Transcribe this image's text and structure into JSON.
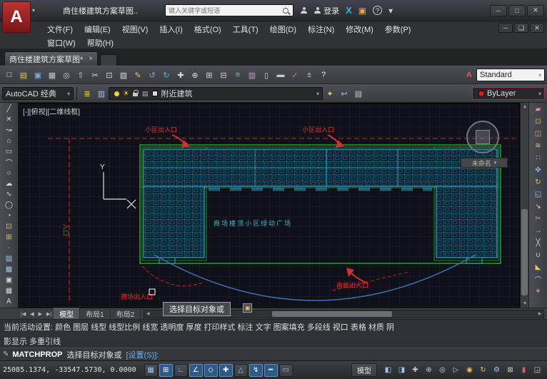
{
  "titlebar": {
    "logo_letter": "A",
    "doc_title": "商住楼建筑方案草图..",
    "search_placeholder": "键入关键字或短语",
    "login": "登录",
    "exchange": "X",
    "box_icon": "▣",
    "help": "?",
    "dropdown": "▾"
  },
  "window": {
    "minimize": "─",
    "maximize": "□",
    "close": "✕"
  },
  "doc_window": {
    "minimize": "─",
    "maximize": "❏",
    "close": "✕"
  },
  "menus": [
    "文件(F)",
    "编辑(E)",
    "视图(V)",
    "插入(I)",
    "格式(O)",
    "工具(T)",
    "绘图(D)",
    "标注(N)",
    "修改(M)",
    "参数(P)"
  ],
  "menus2": [
    "窗口(W)",
    "帮助(H)"
  ],
  "doc_tab": {
    "label": "商住楼建筑方案草图*",
    "close": "×"
  },
  "toolbar1": [
    {
      "name": "qnew-icon",
      "glyph": "□",
      "color": "#e8e8e8"
    },
    {
      "name": "open-icon",
      "glyph": "▤",
      "color": "#e8c35a"
    },
    {
      "name": "save-icon",
      "glyph": "▣",
      "color": "#7fa8d9"
    },
    {
      "name": "plot-icon",
      "glyph": "▦",
      "color": "#c9c9c9"
    },
    {
      "name": "plot-preview-icon",
      "glyph": "◎",
      "color": "#c9c9c9"
    },
    {
      "name": "publish-icon",
      "glyph": "⇧",
      "color": "#c9c9c9"
    },
    {
      "name": "cut-icon",
      "glyph": "✂",
      "color": "#d9d9d9"
    },
    {
      "name": "copy-icon",
      "glyph": "⊡",
      "color": "#d9d9d9"
    },
    {
      "name": "paste-icon",
      "glyph": "▧",
      "color": "#d9d9d9"
    },
    {
      "name": "matchprop-icon",
      "glyph": "✎",
      "color": "#e8c35a"
    },
    {
      "name": "undo-icon",
      "glyph": "↺",
      "color": "#6fa8e0"
    },
    {
      "name": "redo-icon",
      "glyph": "↻",
      "color": "#6fa8e0"
    },
    {
      "name": "pan-icon",
      "glyph": "✚",
      "color": "#d9d9d9"
    },
    {
      "name": "zoom-realtime-icon",
      "glyph": "⊕",
      "color": "#d9d9d9"
    },
    {
      "name": "zoom-window-icon",
      "glyph": "⊞",
      "color": "#d9d9d9"
    },
    {
      "name": "zoom-previous-icon",
      "glyph": "⊟",
      "color": "#d9d9d9"
    },
    {
      "name": "properties-icon",
      "glyph": "≡",
      "color": "#8fc08f"
    },
    {
      "name": "designcenter-icon",
      "glyph": "▥",
      "color": "#c9a0c9"
    },
    {
      "name": "toolpalettes-icon",
      "glyph": "▯",
      "color": "#c9c9c9"
    },
    {
      "name": "sheetset-icon",
      "glyph": "▬",
      "color": "#c9c9c9"
    },
    {
      "name": "markup-icon",
      "glyph": "✓",
      "color": "#e07070"
    },
    {
      "name": "quickcalc-icon",
      "glyph": "±",
      "color": "#c9c9c9"
    },
    {
      "name": "help-icon",
      "glyph": "?",
      "color": "#efefef"
    }
  ],
  "standard": {
    "style_icon": "A",
    "combo": "Standard"
  },
  "toolbar2": {
    "workspace": "AutoCAD 经典",
    "icons_left": [
      {
        "name": "layer-properties-icon",
        "glyph": "≣",
        "color": "#e8c35a"
      },
      {
        "name": "layer-filter-icon",
        "glyph": "▥",
        "color": "#9fc3e8"
      }
    ],
    "layer": "附近建筑",
    "icons_right": [
      {
        "name": "make-object-layer-current-icon",
        "glyph": "✦",
        "color": "#e8c35a"
      },
      {
        "name": "layer-previous-icon",
        "glyph": "↩",
        "color": "#9fc3e8"
      },
      {
        "name": "layer-states-icon",
        "glyph": "▤",
        "color": "#c9c9c9"
      }
    ],
    "color": "ByLayer"
  },
  "draw_toolbar": [
    {
      "name": "line-icon",
      "glyph": "╱",
      "color": "#d5d5d5"
    },
    {
      "name": "construction-line-icon",
      "glyph": "✕",
      "color": "#d5d5d5"
    },
    {
      "name": "polyline-icon",
      "glyph": "↝",
      "color": "#d5d5d5"
    },
    {
      "name": "polygon-icon",
      "glyph": "⌂",
      "color": "#d5d5d5"
    },
    {
      "name": "rectangle-icon",
      "glyph": "▭",
      "color": "#d5d5d5"
    },
    {
      "name": "arc-icon",
      "glyph": "⌒",
      "color": "#d5d5d5"
    },
    {
      "name": "circle-icon",
      "glyph": "○",
      "color": "#d5d5d5"
    },
    {
      "name": "revision-cloud-icon",
      "glyph": "☁",
      "color": "#d5d5d5"
    },
    {
      "name": "spline-icon",
      "glyph": "∿",
      "color": "#d5d5d5"
    },
    {
      "name": "ellipse-icon",
      "glyph": "◯",
      "color": "#d5d5d5"
    },
    {
      "name": "ellipse-arc-icon",
      "glyph": "◔",
      "color": "#d5d5d5"
    },
    {
      "name": "insert-block-icon",
      "glyph": "⊡",
      "color": "#e8c35a"
    },
    {
      "name": "make-block-icon",
      "glyph": "⊞",
      "color": "#e8c35a"
    },
    {
      "name": "point-icon",
      "glyph": "∙",
      "color": "#d5d5d5"
    },
    {
      "name": "hatch-icon",
      "glyph": "▨",
      "color": "#9fc3e8"
    },
    {
      "name": "gradient-icon",
      "glyph": "▩",
      "color": "#9fc3e8"
    },
    {
      "name": "region-icon",
      "glyph": "▣",
      "color": "#d5d5d5"
    },
    {
      "name": "table-icon",
      "glyph": "▦",
      "color": "#d5d5d5"
    },
    {
      "name": "mtext-icon",
      "glyph": "A",
      "color": "#d5d5d5"
    }
  ],
  "modify_toolbar": [
    {
      "name": "erase-icon",
      "glyph": "▰",
      "color": "#e09090"
    },
    {
      "name": "copy-object-icon",
      "glyph": "⊡",
      "color": "#e8a060"
    },
    {
      "name": "mirror-icon",
      "glyph": "◫",
      "color": "#e8a060"
    },
    {
      "name": "offset-icon",
      "glyph": "≋",
      "color": "#e8c35a"
    },
    {
      "name": "array-icon",
      "glyph": "∷",
      "color": "#d5d5d5"
    },
    {
      "name": "move-icon",
      "glyph": "✜",
      "color": "#9fc3e8"
    },
    {
      "name": "rotate-icon",
      "glyph": "↻",
      "color": "#e8c35a"
    },
    {
      "name": "scale-icon",
      "glyph": "◱",
      "color": "#9fc3e8"
    },
    {
      "name": "stretch-icon",
      "glyph": "↘",
      "color": "#d5d5d5"
    },
    {
      "name": "trim-icon",
      "glyph": "✂",
      "color": "#e09090"
    },
    {
      "name": "extend-icon",
      "glyph": "→",
      "color": "#9fc3e8"
    },
    {
      "name": "break-icon",
      "glyph": "╳",
      "color": "#d5d5d5"
    },
    {
      "name": "join-icon",
      "glyph": "∪",
      "color": "#d5d5d5"
    },
    {
      "name": "chamfer-icon",
      "glyph": "◣",
      "color": "#e8c35a"
    },
    {
      "name": "fillet-icon",
      "glyph": "⌒",
      "color": "#9fc3e8"
    },
    {
      "name": "explode-icon",
      "glyph": "✶",
      "color": "#e09090"
    }
  ],
  "viewport": {
    "label": "[-][俯视][二维线框]",
    "viewcube": "未命名"
  },
  "plan": {
    "annotations": {
      "entrance_top_left": "小区出入口",
      "entrance_top_right": "小区出入口",
      "plaza": "商场楼顶小区绿动广场",
      "entrance_bottom_right": "南板出入口",
      "entrance_bottom_left": "商场出入口",
      "entrance_left": "入口",
      "axis_y": "Y"
    }
  },
  "layout": {
    "nav": [
      {
        "name": "tab-first-button",
        "glyph": "|◀"
      },
      {
        "name": "tab-prev-button",
        "glyph": "◀"
      },
      {
        "name": "tab-next-button",
        "glyph": "▶"
      },
      {
        "name": "tab-last-button",
        "glyph": "▶|"
      }
    ],
    "tabs": [
      "模型",
      "布局1",
      "布局2"
    ]
  },
  "tooltip": {
    "text": "选择目标对象或",
    "badge": "▣"
  },
  "status_info": {
    "line1": "当前活动设置:  颜色  图层  线型  线型比例  线宽  透明度  厚度  打印样式  标注  文字  图案填充  多段线  视口  表格  材质  阴",
    "line2": "影显示  多重引线"
  },
  "command": {
    "icon": "✎",
    "name": "MATCHPROP",
    "text": "选择目标对象或",
    "option": "[设置(S)]:"
  },
  "statusbar": {
    "coords": "25085.1374, -33547.5730, 0.0000",
    "toggles": [
      {
        "name": "snap-toggle",
        "glyph": "▦",
        "active": false
      },
      {
        "name": "grid-toggle",
        "glyph": "⊞",
        "active": true
      },
      {
        "name": "ortho-toggle",
        "glyph": "∟",
        "active": false
      },
      {
        "name": "polar-toggle",
        "glyph": "∠",
        "active": true
      },
      {
        "name": "osnap-toggle",
        "glyph": "◇",
        "active": true
      },
      {
        "name": "otrack-toggle",
        "glyph": "✚",
        "active": true
      },
      {
        "name": "ducs-toggle",
        "glyph": "△",
        "active": false
      },
      {
        "name": "dyn-toggle",
        "glyph": "↯",
        "active": true
      },
      {
        "name": "lwt-toggle",
        "glyph": "━",
        "active": true
      },
      {
        "name": "qp-toggle",
        "glyph": "▭",
        "active": false
      }
    ],
    "model": "模型",
    "right_icons": [
      {
        "name": "quick-view-layouts-icon",
        "glyph": "◧",
        "color": "#9fc3e8"
      },
      {
        "name": "quick-view-drawings-icon",
        "glyph": "◨",
        "color": "#9fc3e8"
      },
      {
        "name": "pan-statusbar-icon",
        "glyph": "✚",
        "color": "#c9c9c9"
      },
      {
        "name": "zoom-statusbar-icon",
        "glyph": "⊕",
        "color": "#c9c9c9"
      },
      {
        "name": "steering-wheel-icon",
        "glyph": "◎",
        "color": "#c9c9c9"
      },
      {
        "name": "showmotion-icon",
        "glyph": "▷",
        "color": "#c9c9c9"
      },
      {
        "name": "annotation-visibility-icon",
        "glyph": "◉",
        "color": "#e8c35a"
      },
      {
        "name": "annotation-autoscale-icon",
        "glyph": "↻",
        "color": "#e8c35a"
      },
      {
        "name": "workspace-switch-icon",
        "glyph": "⚙",
        "color": "#9fc3e8"
      },
      {
        "name": "toolbar-lock-icon",
        "glyph": "⊠",
        "color": "#c9c9c9"
      },
      {
        "name": "performance-icon",
        "glyph": "▮",
        "color": "#d06060"
      },
      {
        "name": "clean-screen-icon",
        "glyph": "◲",
        "color": "#c9c9c9"
      }
    ]
  }
}
